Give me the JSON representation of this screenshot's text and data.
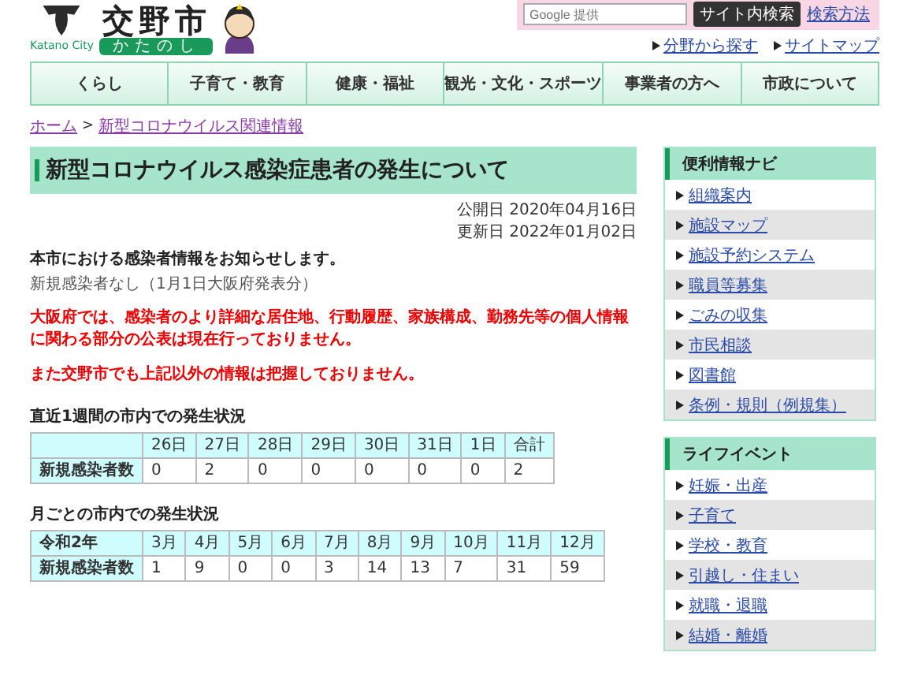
{
  "header": {
    "logo": {
      "name": "交野市",
      "name_en": "Katano City",
      "kana": "かたのし"
    },
    "search": {
      "placeholder": "Google 提供",
      "button": "サイト内検索",
      "help": "検索方法"
    },
    "links": [
      "分野から探す",
      "サイトマップ"
    ]
  },
  "nav": [
    "くらし",
    "子育て・教育",
    "健康・福祉",
    "観光・文化・スポーツ",
    "事業者の方へ",
    "市政について"
  ],
  "breadcrumb": {
    "separator": ">",
    "items": [
      "ホーム",
      "新型コロナウイルス関連情報"
    ]
  },
  "article": {
    "title": "新型コロナウイルス感染症患者の発生について",
    "dates": [
      "公開日 2020年04月16日",
      "更新日 2022年01月02日"
    ],
    "lead": "本市における感染者情報をお知らせします。",
    "status": "新規感染者なし（1月1日大阪府発表分）",
    "notices": [
      "大阪府では、感染者のより詳細な居住地、行動履歴、家族構成、勤務先等の個人情報に関わる部分の公表は現在行っておりません。",
      "また交野市でも上記以外の情報は把握しておりません。"
    ],
    "tables": [
      {
        "caption": "直近1週間の市内での発生状況",
        "columns": [
          "26日",
          "27日",
          "28日",
          "29日",
          "30日",
          "31日",
          "1日",
          "合計"
        ],
        "rows": [
          {
            "label": "新規感染者数",
            "cells": [
              "0",
              "2",
              "0",
              "0",
              "0",
              "0",
              "0",
              "2"
            ]
          }
        ]
      },
      {
        "caption": "月ごとの市内での発生状況",
        "corner": "令和2年",
        "columns": [
          "3月",
          "4月",
          "5月",
          "6月",
          "7月",
          "8月",
          "9月",
          "10月",
          "11月",
          "12月"
        ],
        "rows": [
          {
            "label": "新規感染者数",
            "cells": [
              "1",
              "9",
              "0",
              "0",
              "3",
              "14",
              "13",
              "7",
              "31",
              "59"
            ]
          }
        ]
      }
    ]
  },
  "sidebar": [
    {
      "title": "便利情報ナビ",
      "items": [
        "組織案内",
        "施設マップ",
        "施設予約システム",
        "職員等募集",
        "ごみの収集",
        "市民相談",
        "図書館",
        "条例・規則（例規集）"
      ]
    },
    {
      "title": "ライフイベント",
      "items": [
        "妊娠・出産",
        "子育て",
        "学校・教育",
        "引越し・住まい",
        "就職・退職",
        "結婚・離婚"
      ]
    }
  ]
}
